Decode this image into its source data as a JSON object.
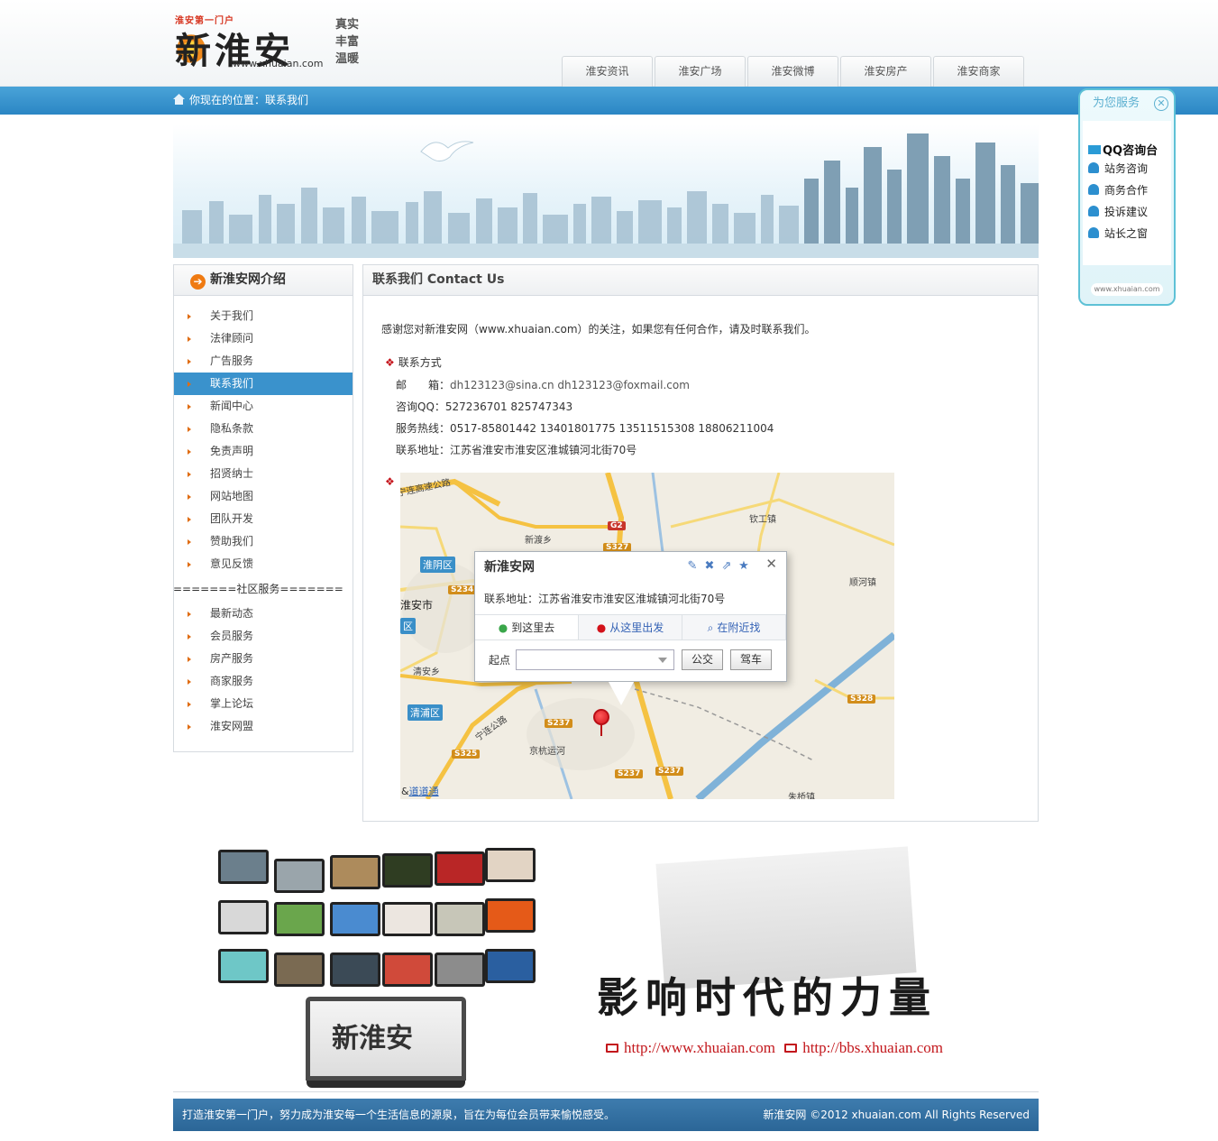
{
  "header": {
    "logo_small": "淮安第一门户",
    "logo_text": "新淮安",
    "logo_url": "www.xhuaian.com",
    "motto": [
      "真实",
      "丰富",
      "温暖"
    ],
    "nav": [
      "淮安资讯",
      "淮安广场",
      "淮安微博",
      "淮安房产",
      "淮安商家"
    ]
  },
  "breadcrumb": {
    "text": "你现在的位置：联系我们"
  },
  "sidebar": {
    "title": "新淮安网介绍",
    "items": [
      "关于我们",
      "法律顾问",
      "广告服务",
      "联系我们",
      "新闻中心",
      "隐私条款",
      "免责声明",
      "招贤纳士",
      "网站地图",
      "团队开发",
      "赞助我们",
      "意见反馈"
    ],
    "active_item": "联系我们",
    "divider_label": "=======社区服务=======",
    "community_items": [
      "最新动态",
      "会员服务",
      "房产服务",
      "商家服务",
      "掌上论坛",
      "淮安网盟"
    ]
  },
  "main": {
    "title": "联系我们 Contact Us",
    "intro": "感谢您对新淮安网（www.xhuaian.com）的关注，如果您有任何合作，请及时联系我们。",
    "contact_heading": "联系方式",
    "email_label": "邮　　箱：",
    "email_value": "dh123123@sina.cn  dh123123@foxmail.com",
    "qq_label": "咨询QQ：",
    "qq_value": "527236701  825747343",
    "hotline_label": "服务热线：",
    "hotline_value": "0517-85801442   13401801775  13511515308  18806211004",
    "address_label": "联系地址：",
    "address_value": "江苏省淮安市淮安区淮城镇河北街70号"
  },
  "map": {
    "labels": {
      "road1": "宁连高速公路",
      "xindu": "新渡乡",
      "qingong": "钦工镇",
      "shunhe": "顺河镇",
      "huaiyin": "淮阴区",
      "huaian_city": "淮安市",
      "qu": "区",
      "qingan": "清安乡",
      "qingpu": "清浦区",
      "jinghang": "京杭运河",
      "ninglian": "宁连公路",
      "zhuqiao": "朱桥镇",
      "g2": "G2",
      "s327": "S327",
      "s234": "S234",
      "s237a": "S237",
      "s237b": "S237",
      "s237c": "S237",
      "s325": "S325",
      "s328": "S328"
    },
    "popup": {
      "title": "新淮安网",
      "address": "联系地址：江苏省淮安市淮安区淮城镇河北街70号",
      "tabs": [
        "到这里去",
        "从这里出发",
        "在附近找"
      ],
      "start_label": "起点",
      "bus_button": "公交",
      "drive_button": "驾车"
    },
    "copyright_prefix": "&",
    "copyright_link": "道道通"
  },
  "promo": {
    "slogan": "影响时代的力量",
    "link1": "http://www.xhuaian.com",
    "link2": "http://bbs.xhuaian.com",
    "laptop_logo": "新淮安"
  },
  "footer": {
    "left": "打造淮安第一门户，努力成为淮安每一个生活信息的源泉，旨在为每位会员带来愉悦感受。",
    "right": "新淮安网 ©2012 xhuaian.com All Rights Reserved"
  },
  "service": {
    "title": "为您服务",
    "qq_title": "QQ咨询台",
    "items": [
      "站务咨询",
      "商务合作",
      "投诉建议",
      "站长之窗"
    ],
    "footer": "www.xhuaian.com"
  },
  "colors": {
    "accent_blue": "#2b86c4",
    "orange": "#ef7a12",
    "red": "#c5161d"
  }
}
